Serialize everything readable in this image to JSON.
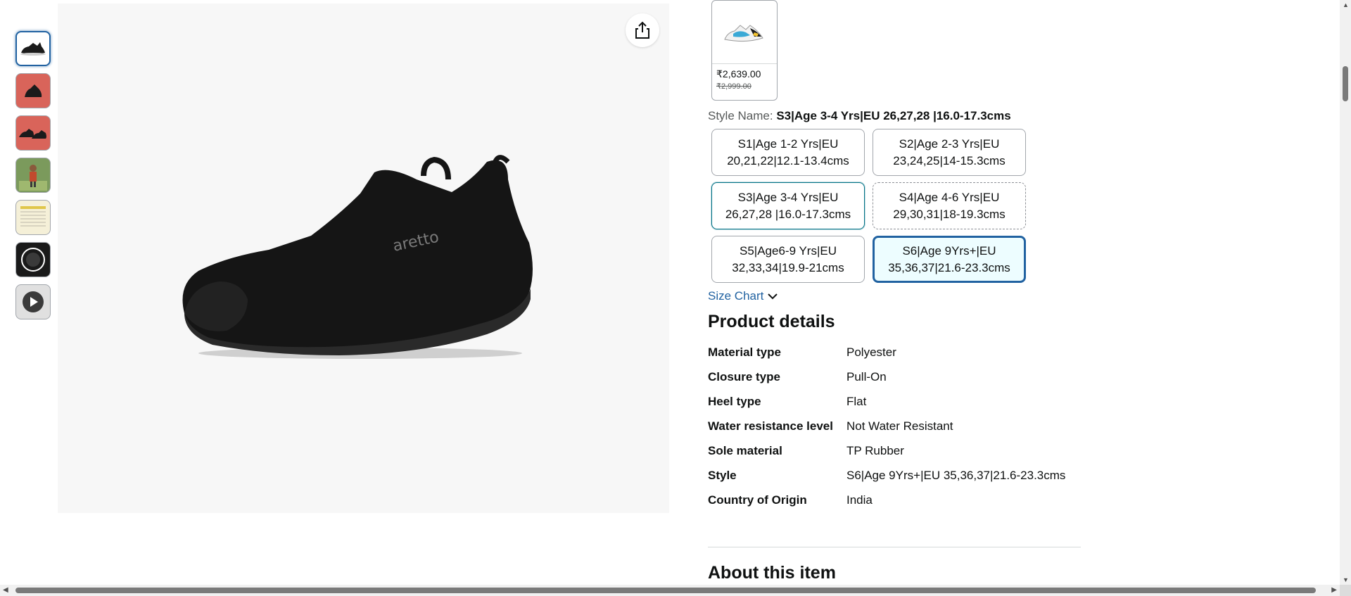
{
  "thumbnails": [
    {
      "name": "thumb-shoe-black",
      "variant": "selected"
    },
    {
      "name": "thumb-shoe-red-1",
      "variant": "red"
    },
    {
      "name": "thumb-shoe-red-2",
      "variant": "red"
    },
    {
      "name": "thumb-child-outdoor",
      "variant": "green"
    },
    {
      "name": "thumb-size-chart",
      "variant": "chart"
    },
    {
      "name": "thumb-feature-badge",
      "variant": "dark"
    },
    {
      "name": "thumb-video",
      "variant": "video"
    }
  ],
  "main_image": {
    "brand_mark": "aretto",
    "share_icon": "share-icon"
  },
  "swatch": {
    "price": "₹2,639.00",
    "mrp": "₹2,999.00"
  },
  "style": {
    "label": "Style Name: ",
    "value": "S3|Age 3-4 Yrs|EU 26,27,28 |16.0-17.3cms"
  },
  "sizes": [
    {
      "line1": "S1|Age 1-2 Yrs|EU",
      "line2": "20,21,22|12.1-13.4cms",
      "state": "normal"
    },
    {
      "line1": "S2|Age 2-3 Yrs|EU",
      "line2": "23,24,25|14-15.3cms",
      "state": "normal"
    },
    {
      "line1": "S3|Age 3-4 Yrs|EU",
      "line2": "26,27,28 |16.0-17.3cms",
      "state": "hover"
    },
    {
      "line1": "S4|Age 4-6 Yrs|EU",
      "line2": "29,30,31|18-19.3cms",
      "state": "unavailable"
    },
    {
      "line1": "S5|Age6-9 Yrs|EU",
      "line2": "32,33,34|19.9-21cms",
      "state": "normal"
    },
    {
      "line1": "S6|Age 9Yrs+|EU",
      "line2": "35,36,37|21.6-23.3cms",
      "state": "selected"
    }
  ],
  "size_chart": {
    "label": "Size Chart",
    "icon": "chevron-down-icon"
  },
  "product_details": {
    "title": "Product details",
    "rows": [
      {
        "key": "Material type",
        "value": "Polyester"
      },
      {
        "key": "Closure type",
        "value": "Pull-On"
      },
      {
        "key": "Heel type",
        "value": "Flat"
      },
      {
        "key": "Water resistance level",
        "value": "Not Water Resistant"
      },
      {
        "key": "Sole material",
        "value": "TP Rubber"
      },
      {
        "key": "Style",
        "value": "S6|Age 9Yrs+|EU 35,36,37|21.6-23.3cms"
      },
      {
        "key": "Country of Origin",
        "value": "India"
      }
    ]
  },
  "about": {
    "title": "About this item"
  },
  "colors": {
    "link": "#2162a1",
    "selected_border": "#2162a1",
    "text": "#0f1111"
  }
}
